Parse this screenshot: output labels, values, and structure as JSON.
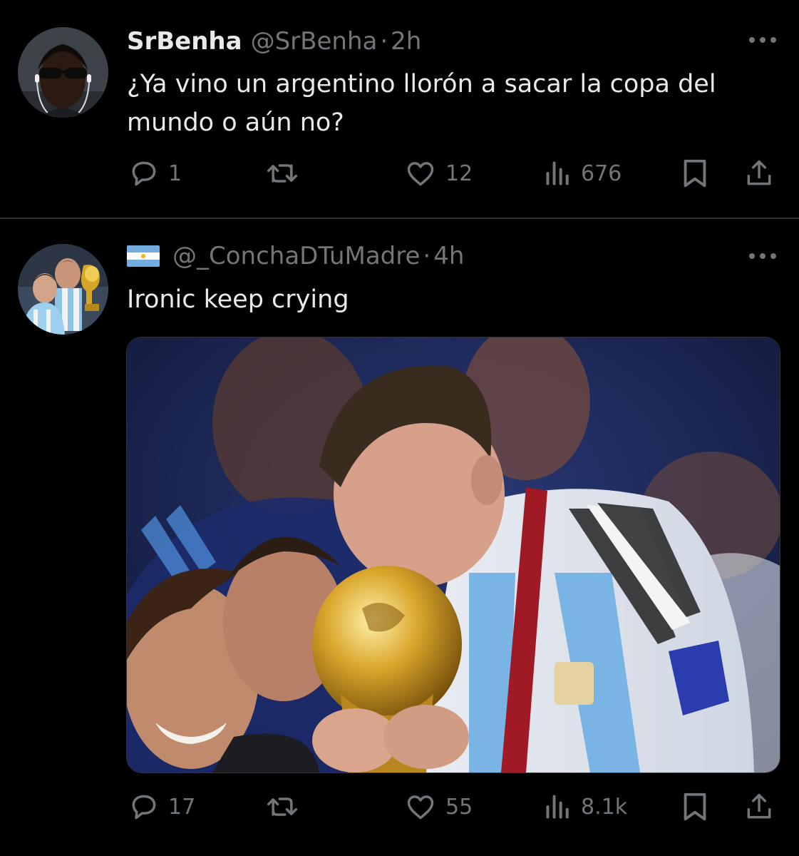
{
  "tweets": [
    {
      "display_name": "SrBenha",
      "handle": "@SrBenha",
      "separator": "·",
      "time": "2h",
      "text": "¿Ya vino un argentino llorón a sacar la copa del mundo o aún no?",
      "stats": {
        "replies": "1",
        "retweets": "",
        "likes": "12",
        "views": "676"
      }
    },
    {
      "display_name": "",
      "flag": "argentina-flag",
      "handle": "@_ConchaDTuMadre",
      "separator": "·",
      "time": "4h",
      "text": "Ironic keep crying",
      "has_media": true,
      "stats": {
        "replies": "17",
        "retweets": "",
        "likes": "55",
        "views": "8.1k"
      }
    }
  ],
  "icons": {
    "reply": "speech-bubble-icon",
    "retweet": "retweet-arrows-icon",
    "like": "heart-icon",
    "views": "bar-chart-icon",
    "bookmark": "bookmark-icon",
    "share": "share-upload-icon",
    "more": "more-dots-icon"
  },
  "colors": {
    "background": "#000000",
    "text_primary": "#e7e9ea",
    "text_secondary": "#71767b",
    "divider": "#2f3336",
    "flag_blue": "#74acdf",
    "flag_sun": "#f6b40e"
  }
}
